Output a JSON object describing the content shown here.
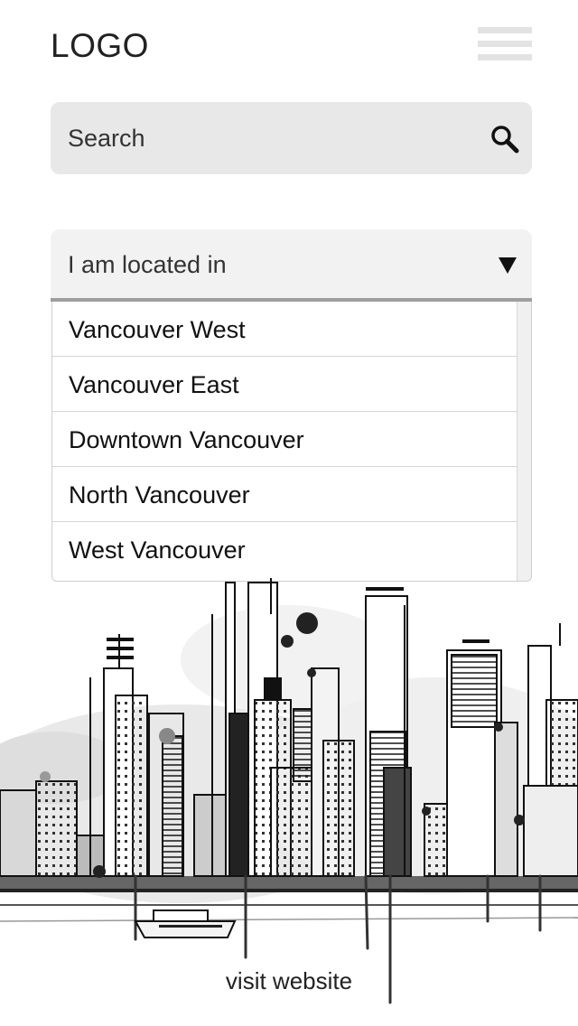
{
  "header": {
    "logo": "LOGO",
    "menu_icon": "hamburger-menu-icon"
  },
  "search": {
    "placeholder": "Search",
    "icon": "search-icon"
  },
  "location_select": {
    "label": "I am located in",
    "icon": "caret-down-icon",
    "options": [
      "Vancouver West",
      "Vancouver East",
      "Downtown Vancouver",
      "North Vancouver",
      "West Vancouver"
    ]
  },
  "hero": {
    "illustration": "city-skyline-sketch"
  },
  "footer": {
    "link": "visit website"
  }
}
